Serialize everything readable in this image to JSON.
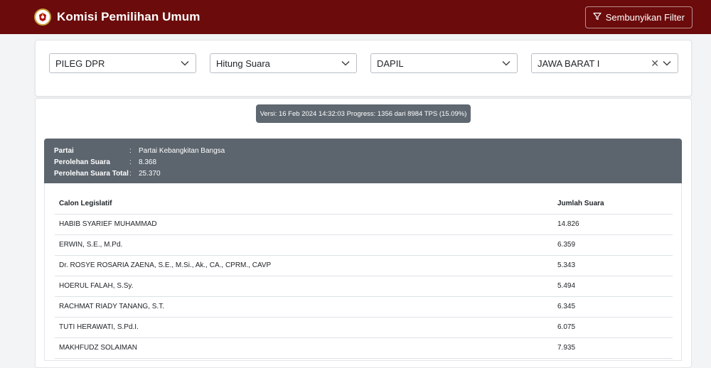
{
  "app": {
    "title": "Komisi Pemilihan Umum"
  },
  "header": {
    "filter_button_label": "Sembunyikan Filter"
  },
  "filters": {
    "election_type": "PILEG DPR",
    "mode": "Hitung Suara",
    "region_level": "DAPIL",
    "region": "JAWA BARAT I"
  },
  "version_info": "Versi: 16 Feb 2024 14:32:03 Progress: 1356 dari 8984 TPS (15.09%)",
  "party": {
    "label_party": "Partai",
    "label_votes": "Perolehan Suara",
    "label_total": "Perolehan Suara Total",
    "sep": ":",
    "name": "Partai Kebangkitan Bangsa",
    "votes": "8.368",
    "total": "25.370"
  },
  "table": {
    "headers": [
      "Calon Legislatif",
      "Jumlah Suara"
    ],
    "rows": [
      {
        "name": "HABIB SYARIEF MUHAMMAD",
        "votes": "14.826"
      },
      {
        "name": "ERWIN, S.E., M.Pd.",
        "votes": "6.359"
      },
      {
        "name": "Dr. ROSYE ROSARIA ZAENA, S.E., M.Si., Ak., CA., CPRM., CAVP",
        "votes": "5.343"
      },
      {
        "name": "HOERUL FALAH, S.Sy.",
        "votes": "5.494"
      },
      {
        "name": "RACHMAT RIADY TANANG, S.T.",
        "votes": "6.345"
      },
      {
        "name": "TUTI HERAWATI, S.Pd.I.",
        "votes": "6.075"
      },
      {
        "name": "MAKHFUDZ SOLAIMAN",
        "votes": "7.935"
      }
    ]
  },
  "icons": {
    "logo": "kpu-logo-icon",
    "filter": "filter-icon",
    "chevron": "chevron-down-icon",
    "clear": "clear-x-icon"
  },
  "colors": {
    "header_bg": "#6b0b0b",
    "panel_bg": "#5c656e",
    "badge_bg": "#5f6870"
  }
}
